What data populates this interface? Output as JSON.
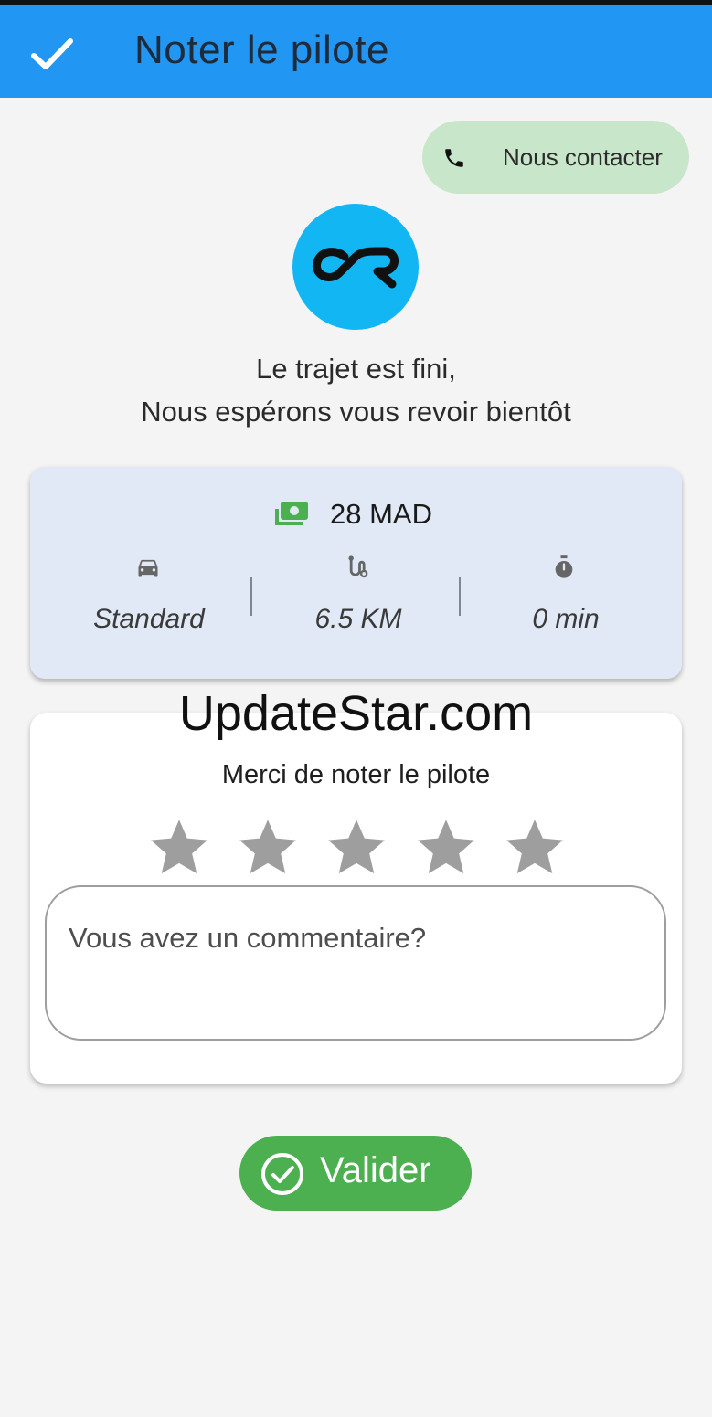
{
  "appbar": {
    "title": "Noter le pilote",
    "confirm_icon": "check-icon"
  },
  "contact": {
    "label": "Nous contacter",
    "icon": "phone-icon"
  },
  "logo": {
    "alt": "app-logo"
  },
  "message": {
    "line1": "Le trajet est fini,",
    "line2": "Nous espérons vous revoir bientôt"
  },
  "ride": {
    "price": "28 MAD",
    "price_icon": "money-icon",
    "stats": [
      {
        "icon": "car-icon",
        "value": "Standard"
      },
      {
        "icon": "route-icon",
        "value": "6.5 KM"
      },
      {
        "icon": "stopwatch-icon",
        "value": "0 min"
      }
    ]
  },
  "watermark": "UpdateStar.com",
  "rating": {
    "title": "Merci de noter le pilote",
    "stars_total": 5,
    "stars_selected": 0,
    "comment_placeholder": "Vous avez un commentaire?",
    "comment_value": ""
  },
  "submit": {
    "label": "Valider",
    "icon": "check-circle-icon"
  },
  "colors": {
    "appbar": "#2196f3",
    "contact_bg": "#c8e6c9",
    "logo_bg": "#12b6f2",
    "ride_card_bg": "#e0e9f5",
    "star_empty": "#9e9e9e",
    "submit_bg": "#4caf50",
    "money_icon": "#4caf50"
  }
}
